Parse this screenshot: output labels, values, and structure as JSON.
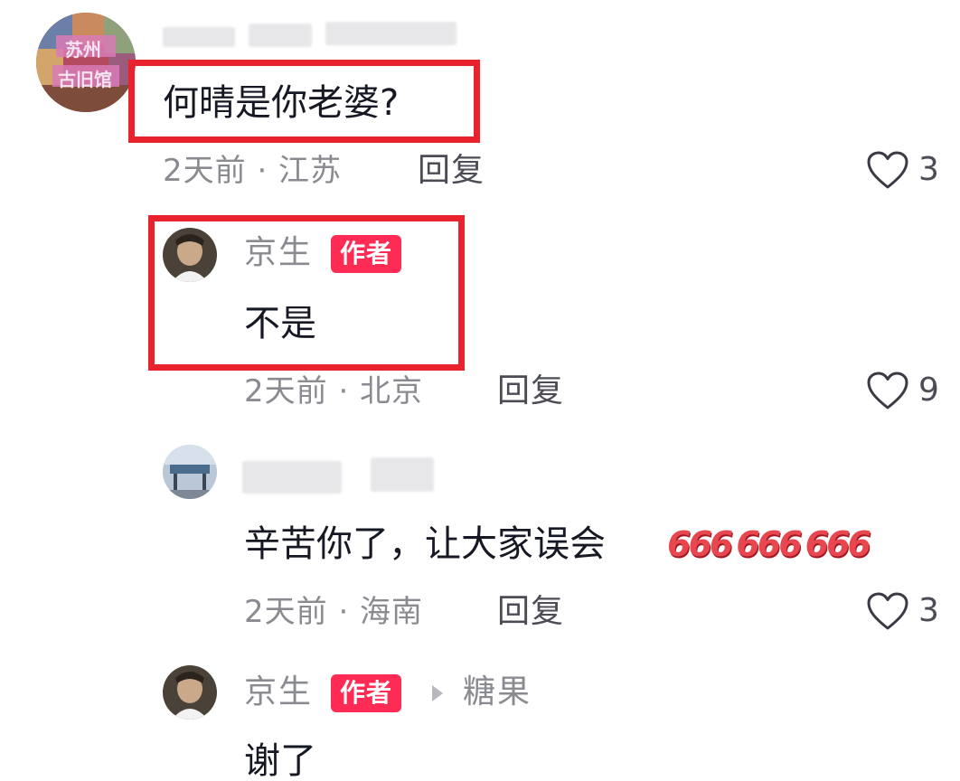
{
  "comments": [
    {
      "text": "何晴是你老婆?",
      "meta": "2天前 · 江苏",
      "reply_label": "回复",
      "likes": "3",
      "avatar_text": [
        "苏州",
        "古旧馆"
      ]
    },
    {
      "author": "京生",
      "badge": "作者",
      "text": "不是",
      "meta": "2天前 · 北京",
      "reply_label": "回复",
      "likes": "9"
    },
    {
      "text": "辛苦你了，让大家误会",
      "emoji": [
        "666",
        "666",
        "666"
      ],
      "meta": "2天前 · 海南",
      "reply_label": "回复",
      "likes": "3"
    },
    {
      "author": "京生",
      "badge": "作者",
      "reply_to": "糖果",
      "text": "谢了"
    }
  ],
  "colors": {
    "highlight_box": "#e8232d",
    "badge_bg": "#fe2c55",
    "meta_text": "#8a8b91"
  }
}
